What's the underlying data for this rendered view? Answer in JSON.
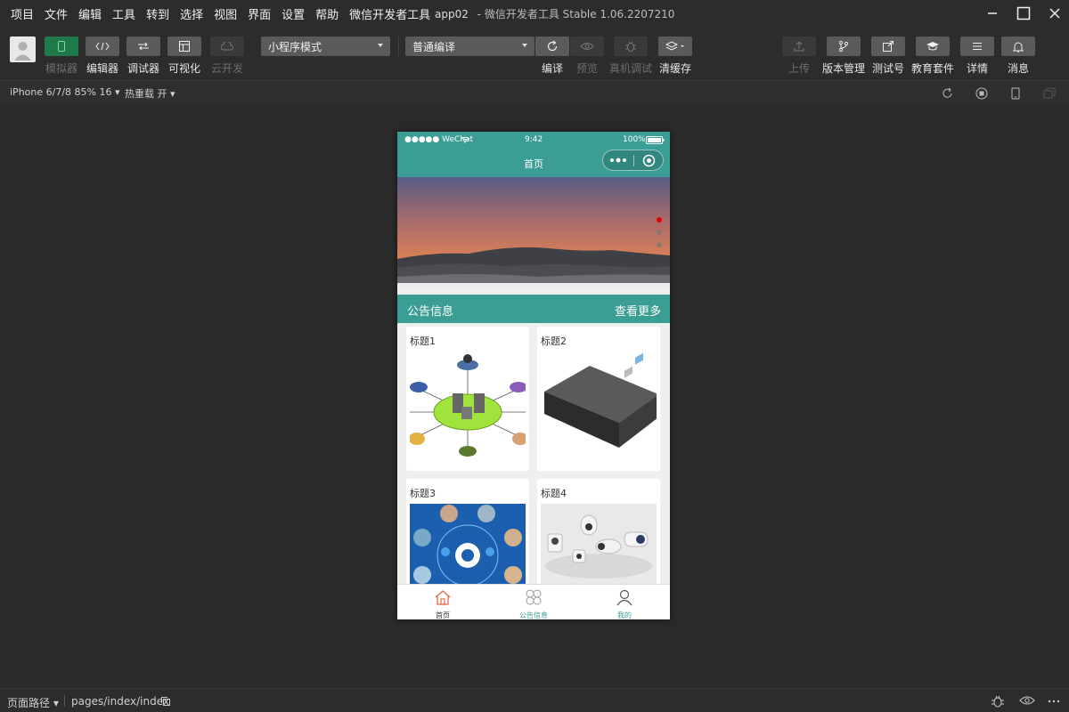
{
  "menu": [
    "项目",
    "文件",
    "编辑",
    "工具",
    "转到",
    "选择",
    "视图",
    "界面",
    "设置",
    "帮助",
    "微信开发者工具"
  ],
  "window": {
    "app": "app02",
    "sep": " - ",
    "title": "微信开发者工具 Stable 1.06.2207210"
  },
  "toolbar": {
    "simulator": "模拟器",
    "editor": "编辑器",
    "debugger": "调试器",
    "visual": "可视化",
    "cloud": "云开发",
    "mode_select": "小程序模式",
    "compile_select": "普通编译",
    "compile": "编译",
    "preview": "预览",
    "real_debug": "真机调试",
    "clear_cache": "清缓存",
    "upload": "上传",
    "version": "版本管理",
    "test_id": "测试号",
    "edu": "教育套件",
    "details": "详情",
    "messages": "消息"
  },
  "subbar": {
    "device": "iPhone 6/7/8 85% 16 ▾",
    "hot_reload": "热重载 开 ▾"
  },
  "phone": {
    "carrier": "●●●●● WeChat",
    "time": "9:42",
    "battery": "100%",
    "nav_title": "首页",
    "notice_title": "公告信息",
    "notice_more": "查看更多",
    "cards": [
      {
        "title": "标题1"
      },
      {
        "title": "标题2"
      },
      {
        "title": "标题3"
      },
      {
        "title": "标题4"
      }
    ],
    "tabs": [
      {
        "label": "首页"
      },
      {
        "label": "公告信息"
      },
      {
        "label": "我的"
      }
    ]
  },
  "statusbar": {
    "page_path_label": "页面路径 ▾",
    "page_path": "pages/index/index"
  },
  "colors": {
    "accent": "#3a9e95",
    "active_green": "#1f7a4a",
    "swiper_active": "#e10000"
  }
}
